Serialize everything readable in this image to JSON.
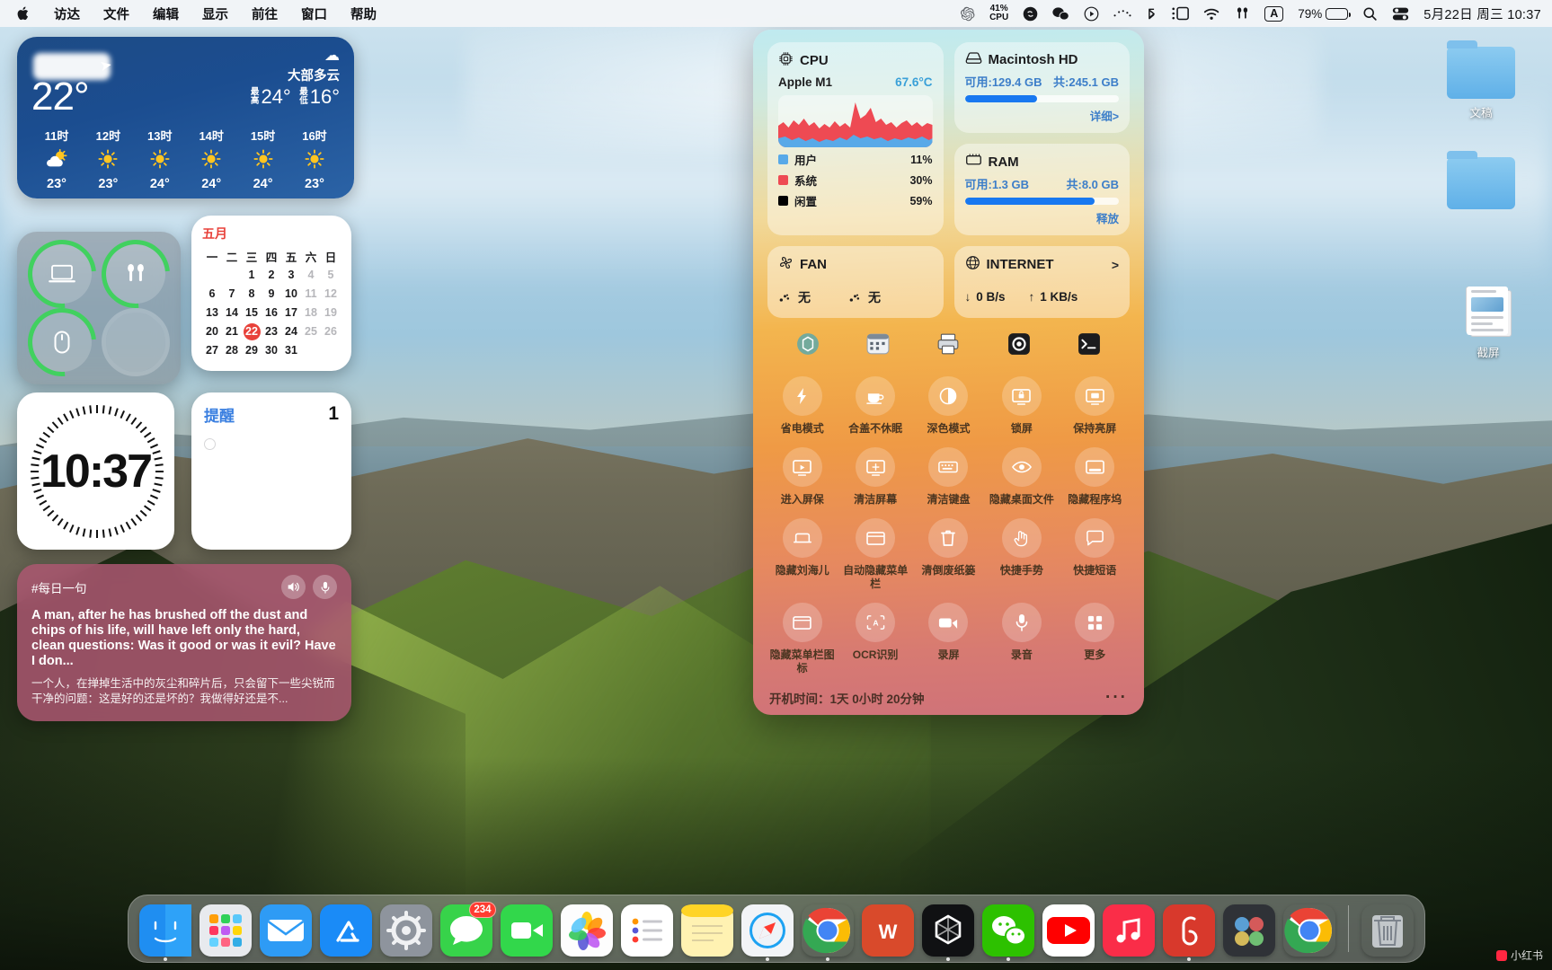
{
  "menubar": {
    "apple_icon": "apple-logo",
    "items": [
      "访达",
      "文件",
      "编辑",
      "显示",
      "前往",
      "窗口",
      "帮助"
    ],
    "status": {
      "cpu_percent": "41%",
      "cpu_label": "CPU",
      "battery_percent": "79%",
      "ime": "A",
      "datetime": "5月22日 周三 10:37",
      "icons": [
        "openai-icon",
        "shazam-icon",
        "wechat-icon",
        "play-icon",
        "dots-icon",
        "bluetooth-icon",
        "screen-mirror-icon",
        "wifi-icon",
        "airpods-icon",
        "search-icon",
        "control-center-icon"
      ]
    }
  },
  "weather": {
    "temp": "22°",
    "condition": "大部多云",
    "high_label": "最高",
    "high": "24°",
    "low_label": "最低",
    "low": "16°",
    "hours": [
      {
        "time": "11时",
        "icon": "partly-cloudy-icon",
        "temp": "23°"
      },
      {
        "time": "12时",
        "icon": "sun-icon",
        "temp": "23°"
      },
      {
        "time": "13时",
        "icon": "sun-icon",
        "temp": "24°"
      },
      {
        "time": "14时",
        "icon": "sun-icon",
        "temp": "24°"
      },
      {
        "time": "15时",
        "icon": "sun-icon",
        "temp": "24°"
      },
      {
        "time": "16时",
        "icon": "sun-icon",
        "temp": "23°"
      }
    ]
  },
  "battery_rings": [
    {
      "icon": "laptop-icon",
      "charged": true
    },
    {
      "icon": "airpods-icon",
      "charged": true
    },
    {
      "icon": "mouse-icon",
      "charged": true
    },
    {
      "icon": "",
      "charged": false
    }
  ],
  "calendar": {
    "month": "五月",
    "weekdays": [
      "一",
      "二",
      "三",
      "四",
      "五",
      "六",
      "日"
    ],
    "today": "22",
    "weeks": [
      [
        "",
        "",
        "1",
        "2",
        "3",
        "4",
        "5"
      ],
      [
        "6",
        "7",
        "8",
        "9",
        "10",
        "11",
        "12"
      ],
      [
        "13",
        "14",
        "15",
        "16",
        "17",
        "18",
        "19"
      ],
      [
        "20",
        "21",
        "22",
        "23",
        "24",
        "25",
        "26"
      ],
      [
        "27",
        "28",
        "29",
        "30",
        "31",
        "",
        ""
      ]
    ],
    "dim_columns": [
      5,
      6
    ]
  },
  "clock": {
    "time": "10:37"
  },
  "reminders": {
    "title": "提醒",
    "count": "1"
  },
  "quote": {
    "tag": "#每日一句",
    "english": "A man, after he has brushed off the dust and chips of his life, will have left only the hard, clean questions: Was it good or was it evil? Have I don...",
    "chinese": "一个人，在掸掉生活中的灰尘和碎片后，只会留下一些尖锐而干净的问题：这是好的还是坏的？我做得好还是不...",
    "speaker_icon": "speaker-icon",
    "mic_icon": "mic-icon"
  },
  "desktop_icons": [
    {
      "label": "文稿",
      "icon": "folder-icon"
    },
    {
      "label": "",
      "icon": "folder-icon"
    },
    {
      "label": "截屏",
      "icon": "screenshot-stack-icon"
    }
  ],
  "syspanel": {
    "cpu": {
      "title": "CPU",
      "icon": "chip-icon",
      "chip": "Apple M1",
      "temperature": "67.6°C",
      "legend": [
        {
          "label": "用户",
          "value": "11%",
          "color": "#58a9e8"
        },
        {
          "label": "系统",
          "value": "30%",
          "color": "#ee4a53"
        },
        {
          "label": "闲置",
          "value": "59%",
          "color": "#000000"
        }
      ]
    },
    "disk": {
      "title": "Macintosh HD",
      "icon": "disk-icon",
      "free": "可用:129.4 GB",
      "total": "共:245.1 GB",
      "used_percent": 47,
      "detail_link": "详细>"
    },
    "ram": {
      "title": "RAM",
      "icon": "ram-icon",
      "free": "可用:1.3 GB",
      "total": "共:8.0 GB",
      "used_percent": 84,
      "release_link": "释放"
    },
    "fan": {
      "title": "FAN",
      "icon": "fan-icon",
      "fan1": "无",
      "fan2": "无"
    },
    "internet": {
      "title": "INTERNET",
      "icon": "globe-icon",
      "chevron": ">",
      "down": "0 B/s",
      "up": "1 KB/s"
    },
    "app_shortcuts": [
      "openai-icon",
      "itsycal-icon",
      "printer-icon",
      "camera-icon",
      "terminal-icon"
    ],
    "toggles": [
      {
        "label": "省电模式",
        "icon": "bolt-icon"
      },
      {
        "label": "合盖不休眠",
        "icon": "coffee-icon"
      },
      {
        "label": "深色模式",
        "icon": "contrast-icon"
      },
      {
        "label": "锁屏",
        "icon": "lock-screen-icon"
      },
      {
        "label": "保持亮屏",
        "icon": "display-awake-icon"
      },
      {
        "label": "进入屏保",
        "icon": "screensaver-icon"
      },
      {
        "label": "清洁屏幕",
        "icon": "clean-screen-icon"
      },
      {
        "label": "清洁键盘",
        "icon": "keyboard-icon"
      },
      {
        "label": "隐藏桌面文件",
        "icon": "eye-icon"
      },
      {
        "label": "隐藏程序坞",
        "icon": "dock-hide-icon"
      },
      {
        "label": "隐藏刘海儿",
        "icon": "notch-icon"
      },
      {
        "label": "自动隐藏菜单栏",
        "icon": "menubar-icon"
      },
      {
        "label": "清倒废纸篓",
        "icon": "trash-icon"
      },
      {
        "label": "快捷手势",
        "icon": "gesture-icon"
      },
      {
        "label": "快捷短语",
        "icon": "phrase-icon"
      },
      {
        "label": "隐藏菜单栏图标",
        "icon": "menubar-icons-icon"
      },
      {
        "label": "OCR识别",
        "icon": "ocr-icon"
      },
      {
        "label": "录屏",
        "icon": "video-icon"
      },
      {
        "label": "录音",
        "icon": "mic-icon"
      },
      {
        "label": "更多",
        "icon": "grid-icon"
      }
    ],
    "footer": {
      "uptime": "开机时间：1天 0小时 20分钟",
      "more_icon": "ellipsis-icon"
    }
  },
  "dock": {
    "items": [
      {
        "name": "finder",
        "icon": "finder-icon",
        "badge": "",
        "running": true
      },
      {
        "name": "launchpad",
        "icon": "launchpad-icon",
        "badge": "",
        "running": false
      },
      {
        "name": "mail",
        "icon": "mail-icon",
        "badge": "",
        "running": false
      },
      {
        "name": "app-store",
        "icon": "appstore-icon",
        "badge": "",
        "running": false
      },
      {
        "name": "system-settings",
        "icon": "gear-icon",
        "badge": "",
        "running": false
      },
      {
        "name": "messages",
        "icon": "messages-icon",
        "badge": "234",
        "running": false
      },
      {
        "name": "facetime",
        "icon": "facetime-icon",
        "badge": "",
        "running": false
      },
      {
        "name": "photos",
        "icon": "photos-icon",
        "badge": "",
        "running": false
      },
      {
        "name": "reminders",
        "icon": "reminders-icon",
        "badge": "",
        "running": false
      },
      {
        "name": "notes",
        "icon": "notes-icon",
        "badge": "",
        "running": false
      },
      {
        "name": "safari",
        "icon": "safari-icon",
        "badge": "",
        "running": true
      },
      {
        "name": "chrome",
        "icon": "chrome-icon",
        "badge": "",
        "running": true
      },
      {
        "name": "wps",
        "icon": "wps-icon",
        "badge": "",
        "running": false
      },
      {
        "name": "chatgpt",
        "icon": "openai-icon",
        "badge": "",
        "running": true
      },
      {
        "name": "wechat",
        "icon": "wechat-icon",
        "badge": "",
        "running": true
      },
      {
        "name": "youtube",
        "icon": "youtube-icon",
        "badge": "",
        "running": false
      },
      {
        "name": "music",
        "icon": "music-icon",
        "badge": "",
        "running": false
      },
      {
        "name": "netease-music",
        "icon": "netease-icon",
        "badge": "",
        "running": true
      },
      {
        "name": "davinci-resolve",
        "icon": "resolve-icon",
        "badge": "",
        "running": false
      },
      {
        "name": "chrome-canary",
        "icon": "chrome-icon",
        "badge": "",
        "running": false
      },
      {
        "name": "trash",
        "icon": "trash-icon",
        "badge": "",
        "running": false
      }
    ]
  },
  "watermark": {
    "text": "小红书"
  }
}
